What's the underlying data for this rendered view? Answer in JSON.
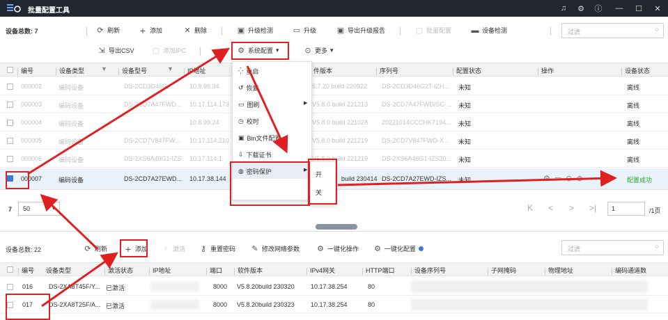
{
  "app": {
    "title": "批量配置工具",
    "logo_icon": "app-logo-icon",
    "controls": [
      "bell-icon",
      "gear-icon",
      "info-icon",
      "minimize-icon",
      "maximize-icon",
      "close-icon"
    ]
  },
  "top": {
    "device_total": "设备总数: 7",
    "toolbar1": {
      "refresh": "刷新",
      "add": "添加",
      "delete": "删除",
      "upgrade_check": "升级检测",
      "upgrade": "升级",
      "export_report": "导出升级报告",
      "batch_config": "批量配置",
      "device_check": "设备检测"
    },
    "search_placeholder": "过滤",
    "toolbar2": {
      "export_csv": "导出CSV",
      "add_ipc": "添加IPC",
      "system_config": "系统配置",
      "more": "更多"
    },
    "columns": [
      "编号",
      "设备类型",
      "设备型号",
      "IP地址",
      "件版本",
      "序列号",
      "配置状态",
      "操作",
      "设备状态"
    ],
    "rows": [
      {
        "no": "000002",
        "type": "编码设备",
        "model": "DS-2CD3D46G...",
        "ip": "10.9.96.34",
        "ver": "5.7.20 build 220922",
        "serial": "DS-2CD3D46G2T-IZH...",
        "cfg": "未知",
        "state": "离线"
      },
      {
        "no": "000003",
        "type": "编码设备",
        "model": "DS-2CD7A47FWD...",
        "ip": "10.17.114.173",
        "ver": "V5.8.0 build 221213",
        "serial": "DS-2CD7A47FWD/SC-...",
        "cfg": "未知",
        "state": "离线"
      },
      {
        "no": "000004",
        "type": "编码设备",
        "model": "",
        "ip": "10.8.99.24",
        "ver": "V5.8.0 build 221028",
        "serial": "20221014CCCHK7194...",
        "cfg": "未知",
        "state": "离线"
      },
      {
        "no": "000005",
        "type": "编码设备",
        "model": "DS-2CD7V847FW...",
        "ip": "10.17.114.210",
        "ver": "V5.8.0 build 221219",
        "serial": "DS-2CD7V847FWD-X...",
        "cfg": "未知",
        "state": "离线"
      },
      {
        "no": "000006",
        "type": "编码设备",
        "model": "DS-2XS6A46G1-IZS",
        "ip": "10.17.114.1",
        "ver": "V5.8.0 build 221219",
        "serial": "DS-2XS6A46G1-IZS20...",
        "cfg": "未知",
        "state": "离线"
      },
      {
        "no": "000007",
        "type": "编码设备",
        "model": "DS-2CD7A27EWD...",
        "ip": "10.17.38.144",
        "ver": "build 230414",
        "serial": "DS-2CD7A27EWD-IZS...",
        "cfg": "未知",
        "state": "配置成功"
      }
    ],
    "pager": {
      "size": "50",
      "page": "1",
      "total": "/1页",
      "count_label": "7"
    },
    "menu": {
      "items": [
        "重启",
        "恢复",
        "图刷",
        "校时",
        "Bin文件配置",
        "下载证书",
        "密码保护"
      ],
      "submenu": [
        "开",
        "关"
      ]
    }
  },
  "bottom": {
    "device_total": "设备总数: 22",
    "toolbar": {
      "refresh": "刷新",
      "add": "添加",
      "activate": "激活",
      "reset_pwd": "重置密码",
      "modify_net": "修改网络参数",
      "one_click_op": "一键化操作",
      "one_click_cfg": "一键化配置"
    },
    "search_placeholder": "过滤",
    "columns": [
      "编号",
      "设备类型",
      "激活状态",
      "IP地址",
      "端口",
      "软件版本",
      "IPv4网关",
      "HTTP端口",
      "设备序列号",
      "子网掩码",
      "物理地址",
      "编码通道数"
    ],
    "rows": [
      {
        "no": "016",
        "type": "DS-2XA8T45F/Y...",
        "act": "已激活",
        "port": "8000",
        "ver": "V5.8.20build 230320",
        "gw": "10.17.38.254",
        "http": "80"
      },
      {
        "no": "017",
        "type": "DS-2XA8T25F/A...",
        "act": "已激活",
        "port": "8000",
        "ver": "V5.8.20build 230323",
        "gw": "10.17.38.254",
        "http": "80"
      }
    ]
  },
  "colors": {
    "accent": "#3a7bd5",
    "red": "#e02020",
    "success": "#2aa52a",
    "titlebar": "#22262f"
  }
}
